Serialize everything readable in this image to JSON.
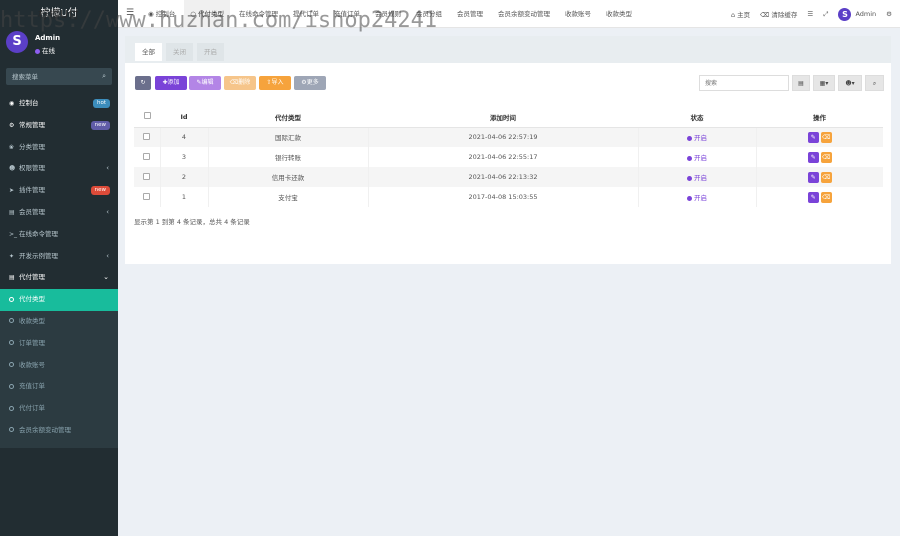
{
  "sidebar": {
    "brand": "柠檬U付",
    "user": {
      "name": "Admin",
      "status": "在线",
      "avatar_letter": "S"
    },
    "search_placeholder": "搜索菜单",
    "items": [
      {
        "label": "控制台",
        "icon": "dashboard-icon",
        "badge": "hot",
        "badge_color": "#3c8dbc"
      },
      {
        "label": "常规管理",
        "icon": "cogs-icon",
        "badge": "new",
        "badge_color": "#605ca8"
      },
      {
        "label": "分类管理",
        "icon": "leaf-icon"
      },
      {
        "label": "权限管理",
        "icon": "group-icon",
        "arrow": "‹"
      },
      {
        "label": "插件管理",
        "icon": "rocket-icon",
        "badge": "new",
        "badge_color": "#dd4b39"
      },
      {
        "label": "会员管理",
        "icon": "list-icon",
        "arrow": "‹"
      },
      {
        "label": "在线命令管理",
        "icon": "terminal-icon"
      },
      {
        "label": "开发示例管理",
        "icon": "magic-icon",
        "arrow": "‹"
      },
      {
        "label": "代付管理",
        "icon": "list-icon",
        "arrow": "⌄"
      }
    ],
    "sub_items": [
      {
        "label": "代付类型",
        "active": true
      },
      {
        "label": "收款类型"
      },
      {
        "label": "订单管理"
      },
      {
        "label": "收款账号"
      },
      {
        "label": "充值订单"
      },
      {
        "label": "代付订单"
      },
      {
        "label": "会员余额变动管理"
      }
    ]
  },
  "topbar": {
    "tabs": [
      "控制台",
      "代付类型",
      "在线命令管理",
      "提代订单",
      "充值订单",
      "会员规则",
      "会员分组",
      "会员管理",
      "会员余额变动管理",
      "收款账号",
      "收款类型"
    ],
    "active_tab": 1,
    "home": "主页",
    "clear_cache": "清除缓存",
    "admin": "Admin"
  },
  "watermark": {
    "title": "柠檬U付",
    "url": "https://www.huzhan.com/ishop24241"
  },
  "subtabs": [
    "全部",
    "关闭",
    "开启"
  ],
  "toolbar": {
    "add": "添加",
    "edit": "编辑",
    "delete": "删除",
    "import": "导入",
    "more": "更多",
    "search_placeholder": "搜索"
  },
  "table": {
    "headers": [
      "Id",
      "代付类型",
      "添加时间",
      "状态",
      "操作"
    ],
    "rows": [
      {
        "id": "4",
        "type": "国际汇款",
        "time": "2021-04-06 22:57:19",
        "status": "开启"
      },
      {
        "id": "3",
        "type": "银行转账",
        "time": "2021-04-06 22:55:17",
        "status": "开启"
      },
      {
        "id": "2",
        "type": "信用卡还款",
        "time": "2021-04-06 22:13:32",
        "status": "开启"
      },
      {
        "id": "1",
        "type": "支付宝",
        "time": "2017-04-08 15:03:55",
        "status": "开启"
      }
    ]
  },
  "footer": "显示第 1 到第 4 条记录，总共 4 条记录",
  "colors": {
    "sidebar_bg": "#222d32",
    "active_green": "#18bc9c",
    "purple": "#7a43d8",
    "orange": "#f6a33c"
  }
}
